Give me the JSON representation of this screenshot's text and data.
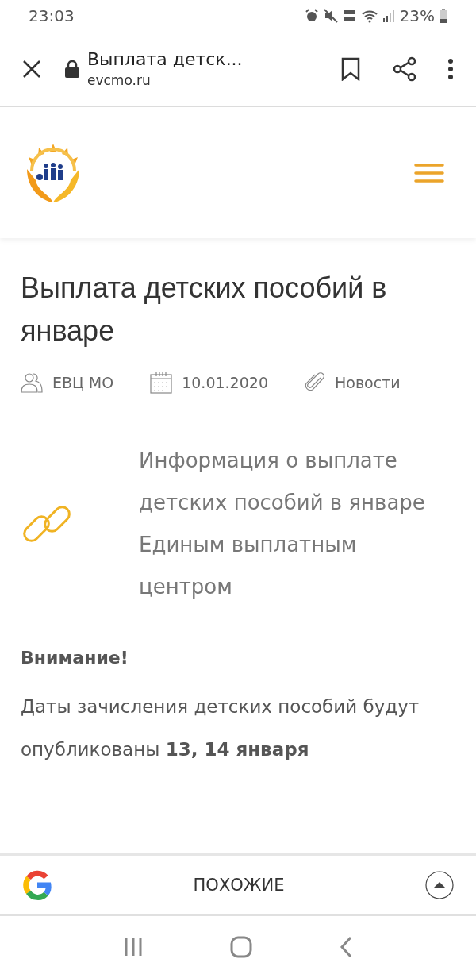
{
  "status_bar": {
    "time": "23:03",
    "battery": "23%"
  },
  "browser_bar": {
    "title": "Выплата детск...",
    "url": "evcmo.ru"
  },
  "article": {
    "title": "Выплата детских пособий в январе",
    "meta": [
      {
        "kind": "author",
        "text": "ЕВЦ МО"
      },
      {
        "kind": "date",
        "text": "10.01.2020"
      },
      {
        "kind": "category",
        "text": "Новости"
      }
    ],
    "link_text": "Информация о выплате детских пособий в январе Единым выплатным центром",
    "notice_heading": "Внимание!",
    "notice_text": "Даты зачисления детских пособий будут опубликованы **13, 14 января**"
  },
  "related_bar": {
    "label": "ПОХОЖИЕ"
  }
}
